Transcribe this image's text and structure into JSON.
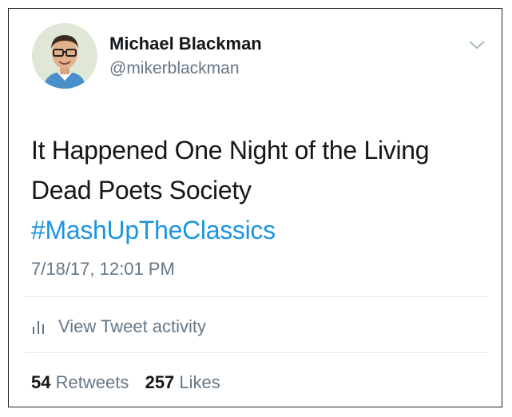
{
  "user": {
    "name": "Michael Blackman",
    "handle": "@mikerblackman"
  },
  "tweet": {
    "text": "It Happened One Night of the Living Dead Poets Society",
    "hashtag": "#MashUpTheClassics",
    "timestamp": "7/18/17, 12:01 PM"
  },
  "activity": {
    "label": "View Tweet activity",
    "icon": "bar-chart-icon"
  },
  "stats": {
    "retweets_count": "54",
    "retweets_label": "Retweets",
    "likes_count": "257",
    "likes_label": "Likes"
  },
  "colors": {
    "text": "#14171a",
    "secondary": "#657786",
    "link": "#1b95e0",
    "divider": "#e1e8ed"
  }
}
